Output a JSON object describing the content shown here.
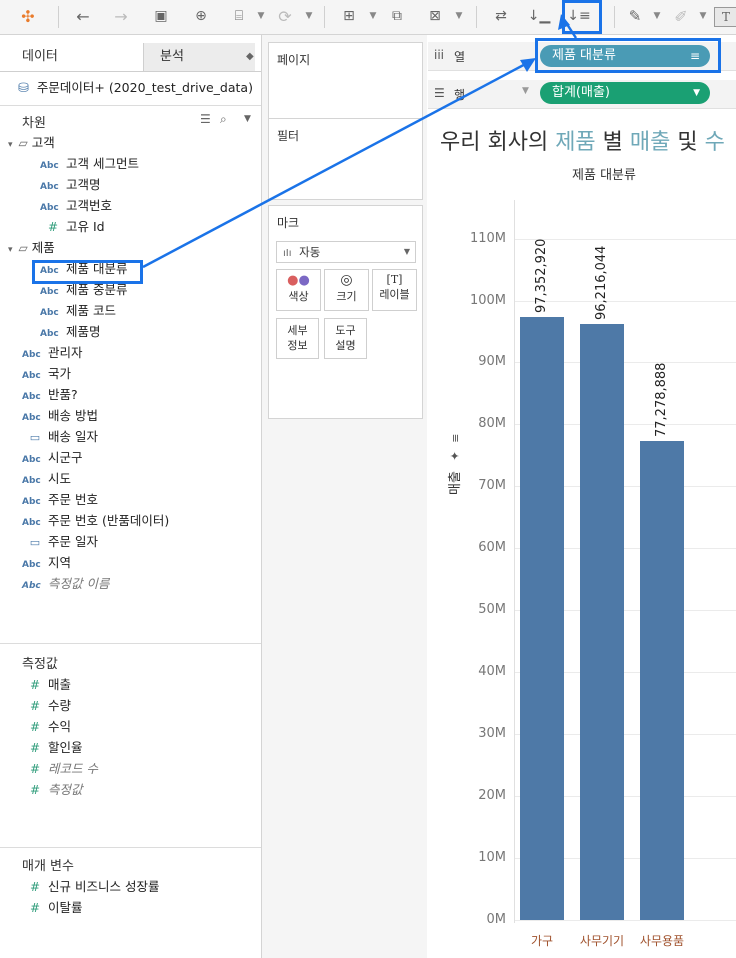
{
  "toolbar": {
    "icons": [
      "tableau-logo-icon",
      "undo-icon",
      "redo-icon",
      "save-icon",
      "new-datasource-icon",
      "datasource-icon",
      "refresh-icon",
      "new-sheet-icon",
      "duplicate-sheet-icon",
      "clear-sheet-icon",
      "swap-icon",
      "sort-ascending-icon",
      "sort-descending-icon",
      "highlight-icon",
      "annotate-icon",
      "text-icon"
    ],
    "text_button": "T"
  },
  "left": {
    "tabs": [
      "데이터",
      "분석"
    ],
    "datasource": "주문데이터+ (2020_test_drive_data)",
    "dimensions_header": "차원",
    "folders": [
      {
        "name": "고객",
        "items": [
          {
            "type": "Abc",
            "label": "고객 세그먼트"
          },
          {
            "type": "Abc",
            "label": "고객명"
          },
          {
            "type": "Abc",
            "label": "고객번호"
          },
          {
            "type": "#",
            "label": "고유 Id"
          }
        ]
      },
      {
        "name": "제품",
        "items": [
          {
            "type": "Abc",
            "label": "제품 대분류"
          },
          {
            "type": "Abc",
            "label": "제품 중분류"
          },
          {
            "type": "Abc",
            "label": "제품 코드"
          },
          {
            "type": "Abc",
            "label": "제품명"
          }
        ]
      }
    ],
    "dimensions": [
      {
        "type": "Abc",
        "label": "관리자"
      },
      {
        "type": "Abc",
        "label": "국가"
      },
      {
        "type": "Abc",
        "label": "반품?"
      },
      {
        "type": "Abc",
        "label": "배송 방법"
      },
      {
        "type": "date",
        "label": "배송 일자"
      },
      {
        "type": "Abc",
        "label": "시군구"
      },
      {
        "type": "Abc",
        "label": "시도"
      },
      {
        "type": "Abc",
        "label": "주문 번호"
      },
      {
        "type": "Abc",
        "label": "주문 번호 (반품데이터)"
      },
      {
        "type": "date",
        "label": "주문 일자"
      },
      {
        "type": "Abc",
        "label": "지역"
      },
      {
        "type": "Abc",
        "label": "측정값 이름"
      }
    ],
    "measures_header": "측정값",
    "measures": [
      {
        "type": "#",
        "label": "매출"
      },
      {
        "type": "#",
        "label": "수량"
      },
      {
        "type": "#",
        "label": "수익"
      },
      {
        "type": "#",
        "label": "할인율"
      },
      {
        "type": "#",
        "label": "레코드 수"
      },
      {
        "type": "#",
        "label": "측정값"
      }
    ],
    "params_header": "매개 변수",
    "params": [
      {
        "type": "#",
        "label": "신규 비즈니스 성장률"
      },
      {
        "type": "#",
        "label": "이탈률"
      }
    ],
    "type_abc": "Abc",
    "type_hash": "#"
  },
  "middle": {
    "pages": "페이지",
    "filters": "필터",
    "marks": "마크",
    "mark_type": "자동",
    "mark_buttons": [
      "색상",
      "크기",
      "레이블"
    ],
    "mark_buttons2": [
      "세부\n정보",
      "도구\n설명"
    ]
  },
  "shelves": {
    "columns_label": "열",
    "rows_label": "행",
    "column_pill": "제품 대분류",
    "row_pill": "합계(매출)",
    "column_pill_color": "#4a9bb5",
    "row_pill_color": "#1aa073"
  },
  "sheet": {
    "title_parts": [
      "우리 회사의 ",
      "제품",
      " 별 ",
      "매출",
      " 및 ",
      "수"
    ],
    "title_accent": "#6fa8b8"
  },
  "chart_data": {
    "type": "bar",
    "title": "제품 대분류",
    "categories": [
      "가구",
      "사무기기",
      "사무용품"
    ],
    "values": [
      97352920,
      96216044,
      77278888
    ],
    "value_labels": [
      "97,352,920",
      "96,216,044",
      "77,278,888"
    ],
    "ylabel": "매출",
    "ylim": [
      0,
      113000000
    ],
    "yticks": [
      0,
      10000000,
      20000000,
      30000000,
      40000000,
      50000000,
      60000000,
      70000000,
      80000000,
      90000000,
      100000000,
      110000000
    ],
    "ytick_labels": [
      "0M",
      "10M",
      "20M",
      "30M",
      "40M",
      "50M",
      "60M",
      "70M",
      "80M",
      "90M",
      "100M",
      "110M"
    ],
    "bar_color": "#4e79a7",
    "grid": true
  }
}
